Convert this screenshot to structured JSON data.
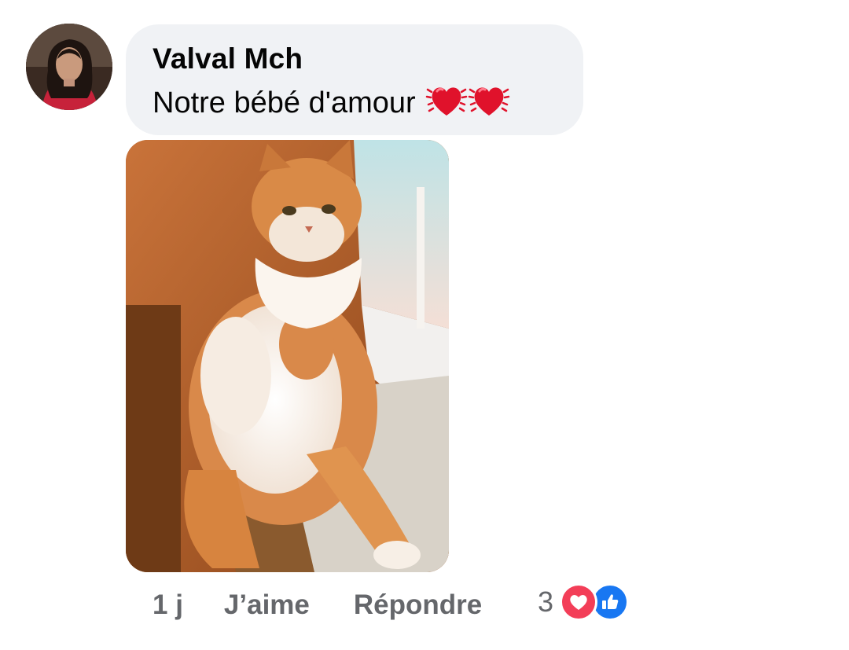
{
  "comment": {
    "author": "Valval Mch",
    "text": "Notre bébé d'amour",
    "emoji": [
      "beating-heart",
      "beating-heart"
    ]
  },
  "actions": {
    "time": "1 j",
    "like_label": "J’aime",
    "reply_label": "Répondre"
  },
  "reactions": {
    "count": "3",
    "types": [
      "love",
      "like"
    ]
  },
  "colors": {
    "bubble": "#f0f2f5",
    "love": "#f33e58",
    "like": "#1877f2",
    "meta_text": "#65676b"
  }
}
